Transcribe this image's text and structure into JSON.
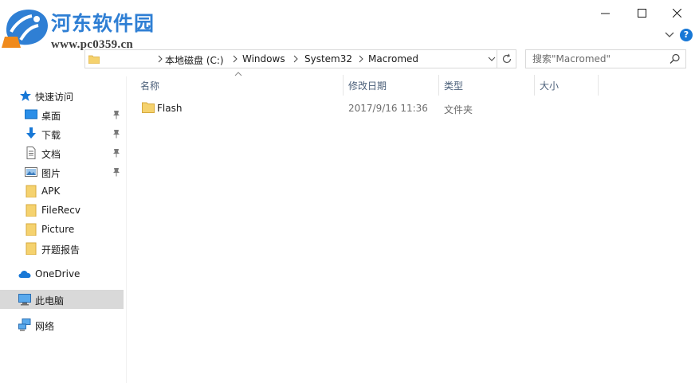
{
  "watermark": {
    "title": "河东软件园",
    "url": "www.pc0359.cn"
  },
  "window": {
    "minimize_glyph": "minimize-icon",
    "maximize_glyph": "maximize-icon",
    "close_glyph": "close-icon"
  },
  "help_label": "?",
  "address": {
    "crumbs": [
      "本地磁盘 (C:)",
      "Windows",
      "System32",
      "Macromed"
    ]
  },
  "search": {
    "placeholder": "搜索\"Macromed\""
  },
  "nav": {
    "quick_access": "快速访问",
    "items": [
      {
        "label": "桌面",
        "icon": "desktop-icon",
        "pinned": true
      },
      {
        "label": "下载",
        "icon": "download-icon",
        "pinned": true
      },
      {
        "label": "文档",
        "icon": "document-icon",
        "pinned": true
      },
      {
        "label": "图片",
        "icon": "pictures-icon",
        "pinned": true
      },
      {
        "label": "APK",
        "icon": "folder-icon",
        "pinned": false
      },
      {
        "label": "FileRecv",
        "icon": "folder-icon",
        "pinned": false
      },
      {
        "label": "Picture",
        "icon": "folder-icon",
        "pinned": false
      },
      {
        "label": "开题报告",
        "icon": "folder-icon",
        "pinned": false
      }
    ],
    "onedrive": "OneDrive",
    "this_pc": "此电脑",
    "network": "网络"
  },
  "columns": {
    "name": "名称",
    "modified": "修改日期",
    "type": "类型",
    "size": "大小"
  },
  "files": [
    {
      "name": "Flash",
      "modified": "2017/9/16 11:36",
      "type": "文件夹",
      "size": ""
    }
  ],
  "colors": {
    "accent": "#1878d6",
    "folder": "#f5d26e",
    "selected": "#d9d9d9"
  }
}
